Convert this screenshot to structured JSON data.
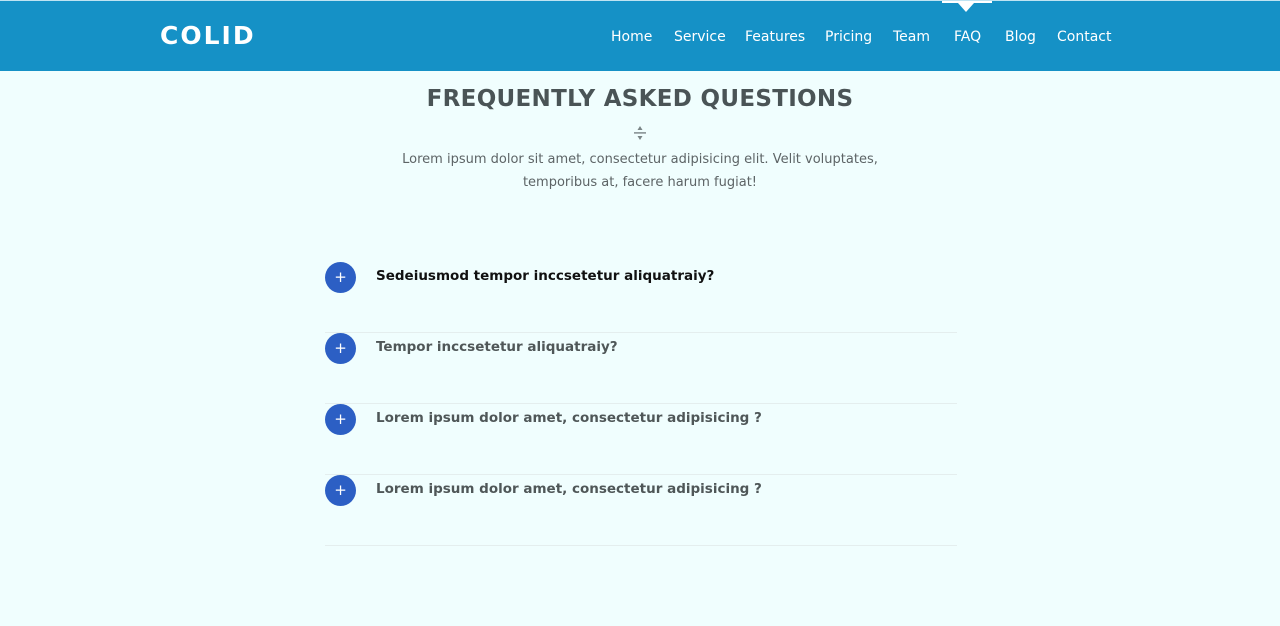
{
  "brand": {
    "logo": "COLID"
  },
  "nav": {
    "items": [
      "Home",
      "Service",
      "Features",
      "Pricing",
      "Team",
      "FAQ",
      "Blog",
      "Contact"
    ],
    "active": "FAQ"
  },
  "section": {
    "title": "FREQUENTLY ASKED QUESTIONS",
    "description": "Lorem ipsum dolor sit amet, consectetur adipisicing elit. Velit voluptates, temporibus at, facere harum fugiat!"
  },
  "faq": {
    "toggle_symbol": "+",
    "questions": [
      "Sedeiusmod tempor inccsetetur aliquatraiy?",
      "Tempor inccsetetur aliquatraiy?",
      "Lorem ipsum dolor amet, consectetur adipisicing ?",
      "Lorem ipsum dolor amet, consectetur adipisicing ?"
    ]
  },
  "colors": {
    "header": "#1591c6",
    "accent": "#2c5fc4",
    "background": "#f0fefe",
    "heading": "#4a5456"
  },
  "icons": {
    "divider": "sort-divider-icon",
    "toggle": "plus-icon"
  }
}
